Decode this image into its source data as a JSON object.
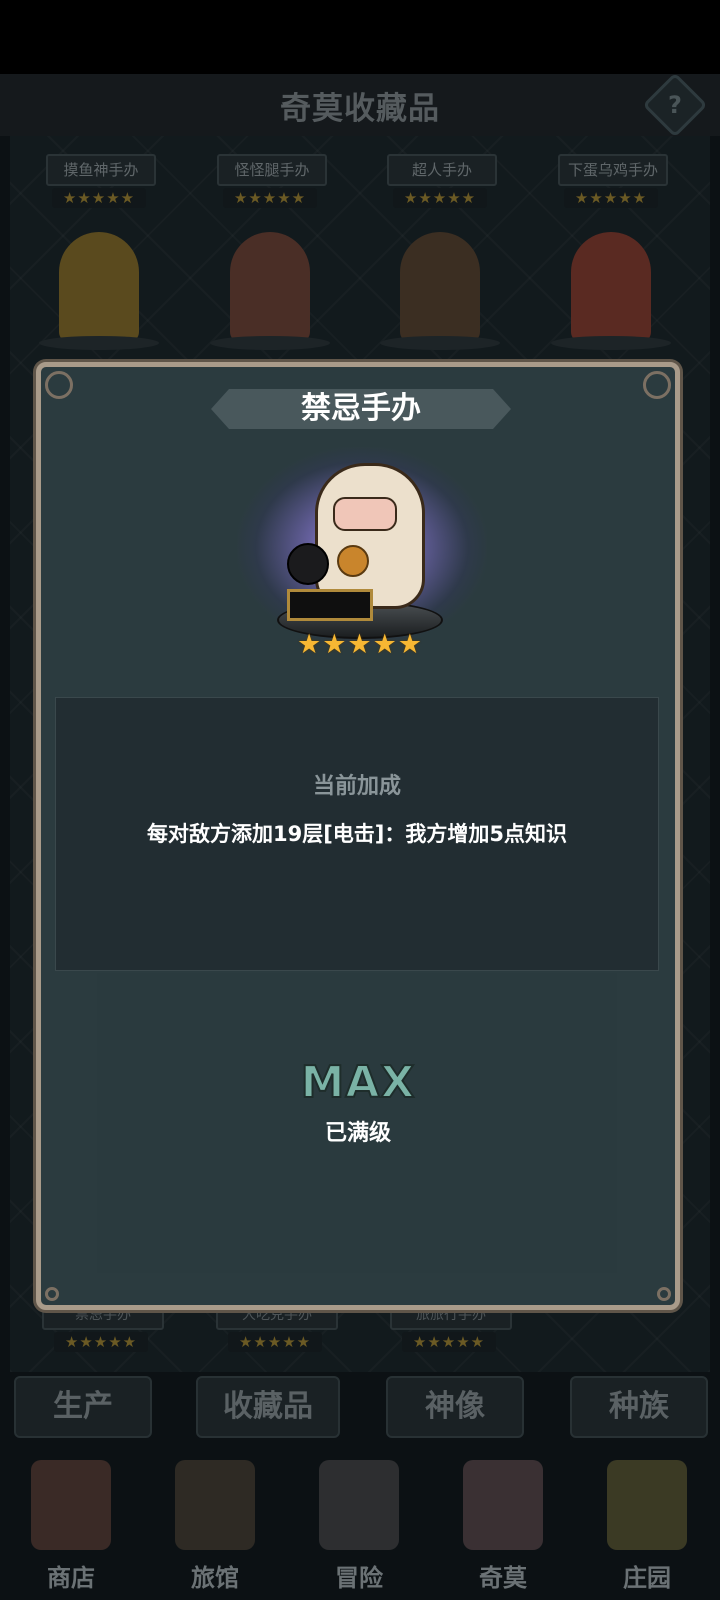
{
  "header": {
    "title": "奇莫收藏品",
    "help_icon": "question-icon",
    "help_label": "?"
  },
  "collection": {
    "top_row": [
      {
        "name": "摸鱼神手办",
        "stars": "★★★★★"
      },
      {
        "name": "怪怪腿手办",
        "stars": "★★★★★"
      },
      {
        "name": "超人手办",
        "stars": "★★★★★"
      },
      {
        "name": "下蛋乌鸡手办",
        "stars": "★★★★★"
      }
    ],
    "bottom_row": [
      {
        "name": "禁忌手办",
        "stars": "★★★★★"
      },
      {
        "name": "大吃克手办",
        "stars": "★★★★★"
      },
      {
        "name": "旅旅行手办",
        "stars": "★★★★★"
      }
    ]
  },
  "modal": {
    "title": "禁忌手办",
    "stars": "★★★★★",
    "bonus_label": "当前加成",
    "bonus_text": "每对敌方添加19层[电击]：我方增加5点知识",
    "max_label": "MAX",
    "maxed_label": "已满级"
  },
  "subtabs": [
    "生产",
    "收藏品",
    "神像",
    "种族"
  ],
  "bottom_nav": [
    {
      "label": "商店",
      "icon": "shop-icon"
    },
    {
      "label": "旅馆",
      "icon": "inn-icon"
    },
    {
      "label": "冒险",
      "icon": "crossed-swords-icon"
    },
    {
      "label": "奇莫",
      "icon": "chimo-character-icon"
    },
    {
      "label": "庄园",
      "icon": "manor-island-icon"
    }
  ],
  "colors": {
    "star": "#f7b733",
    "modal_border": "#a99b8a",
    "max_text": "#7ab3a6"
  }
}
